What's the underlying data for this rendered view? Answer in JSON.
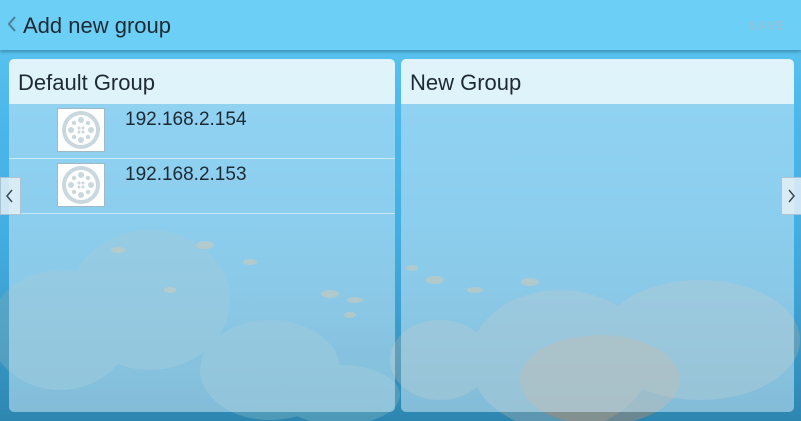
{
  "header": {
    "back_icon": "chevron-left-icon",
    "title": "Add new group",
    "save_label": "SAVE"
  },
  "panels": [
    {
      "title": "Default Group",
      "items": [
        {
          "icon": "led-light-icon",
          "ip": "192.168.2.154"
        },
        {
          "icon": "led-light-icon",
          "ip": "192.168.2.153"
        }
      ]
    },
    {
      "title": "New Group",
      "items": []
    }
  ],
  "nav": {
    "prev_icon": "chevron-left-icon",
    "next_icon": "chevron-right-icon"
  },
  "colors": {
    "topbar": "#6ccff6",
    "save_disabled": "#8fc3dc",
    "text": "#1e2a33"
  }
}
